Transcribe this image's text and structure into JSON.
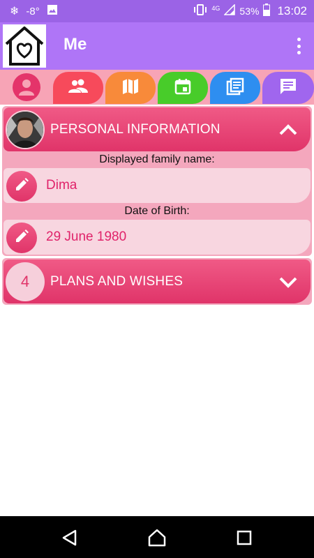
{
  "status_bar": {
    "weather_icon": "snowflake-icon",
    "temperature": "-8°",
    "network": "4G",
    "battery": "53%",
    "time": "13:02"
  },
  "app_bar": {
    "title": "Me",
    "logo": "house-heart-logo",
    "menu_icon": "more-vert-icon"
  },
  "tabs": [
    {
      "name": "me",
      "icon": "person-icon",
      "color": "#e4346a",
      "selected": true
    },
    {
      "name": "people",
      "icon": "group-icon",
      "color": "#f74a5b"
    },
    {
      "name": "map",
      "icon": "map-icon",
      "color": "#f88a3a"
    },
    {
      "name": "calendar",
      "icon": "calendar-icon",
      "color": "#48cc2a"
    },
    {
      "name": "news",
      "icon": "list-icon",
      "color": "#2e8ef0"
    },
    {
      "name": "chat",
      "icon": "chat-icon",
      "color": "#a066ee"
    }
  ],
  "personal_information": {
    "title": "PERSONAL INFORMATION",
    "expanded": true,
    "fields": [
      {
        "label": "Displayed family name:",
        "value": "Dima"
      },
      {
        "label": "Date of Birth:",
        "value": "29 June 1980"
      }
    ]
  },
  "plans_and_wishes": {
    "title": "PLANS AND WISHES",
    "count": "4",
    "expanded": false
  },
  "colors": {
    "accent": "#e03469",
    "app_bar": "#af75f7",
    "status_bar": "#9b63e6"
  }
}
